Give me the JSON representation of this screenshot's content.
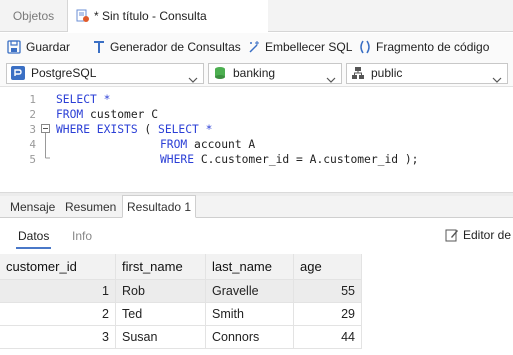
{
  "tabs": {
    "objects": "Objetos",
    "query": "* Sin título - Consulta"
  },
  "toolbar": {
    "save": "Guardar",
    "query_builder": "Generador de Consultas",
    "beautify": "Embellecer SQL",
    "snippet": "Fragmento de código"
  },
  "selectors": {
    "connection": "PostgreSQL",
    "database": "banking",
    "schema": "public"
  },
  "editor": {
    "line_numbers": [
      "1",
      "2",
      "3",
      "4",
      "5"
    ],
    "lines": [
      {
        "a": "SELECT *",
        "b": "",
        "c": "",
        "d": ""
      },
      {
        "a": "FROM",
        "b": " customer C",
        "c": "",
        "d": ""
      },
      {
        "a": "WHERE EXISTS",
        "b": " ( ",
        "c": "SELECT *",
        "d": ""
      },
      {
        "a": "FROM",
        "b": " account A",
        "c": "",
        "d": ""
      },
      {
        "a": "WHERE",
        "b": " C.customer_id = A.customer_id );",
        "c": "",
        "d": ""
      }
    ]
  },
  "result_tabs": [
    "Mensaje",
    "Resumen",
    "Resultado 1"
  ],
  "sub_tabs": [
    "Datos",
    "Info"
  ],
  "form_editor": "Editor de formulario",
  "grid": {
    "columns": [
      "customer_id",
      "first_name",
      "last_name",
      "age"
    ],
    "rows": [
      [
        "1",
        "Rob",
        "Gravelle",
        "55"
      ],
      [
        "2",
        "Ted",
        "Smith",
        "29"
      ],
      [
        "3",
        "Susan",
        "Connors",
        "44"
      ]
    ]
  },
  "colors": {
    "keyword": "#2b3fd6",
    "accent": "#4a78c8",
    "selected_cell": "#d6d6d6",
    "header_bg": "#f2f2f2"
  }
}
